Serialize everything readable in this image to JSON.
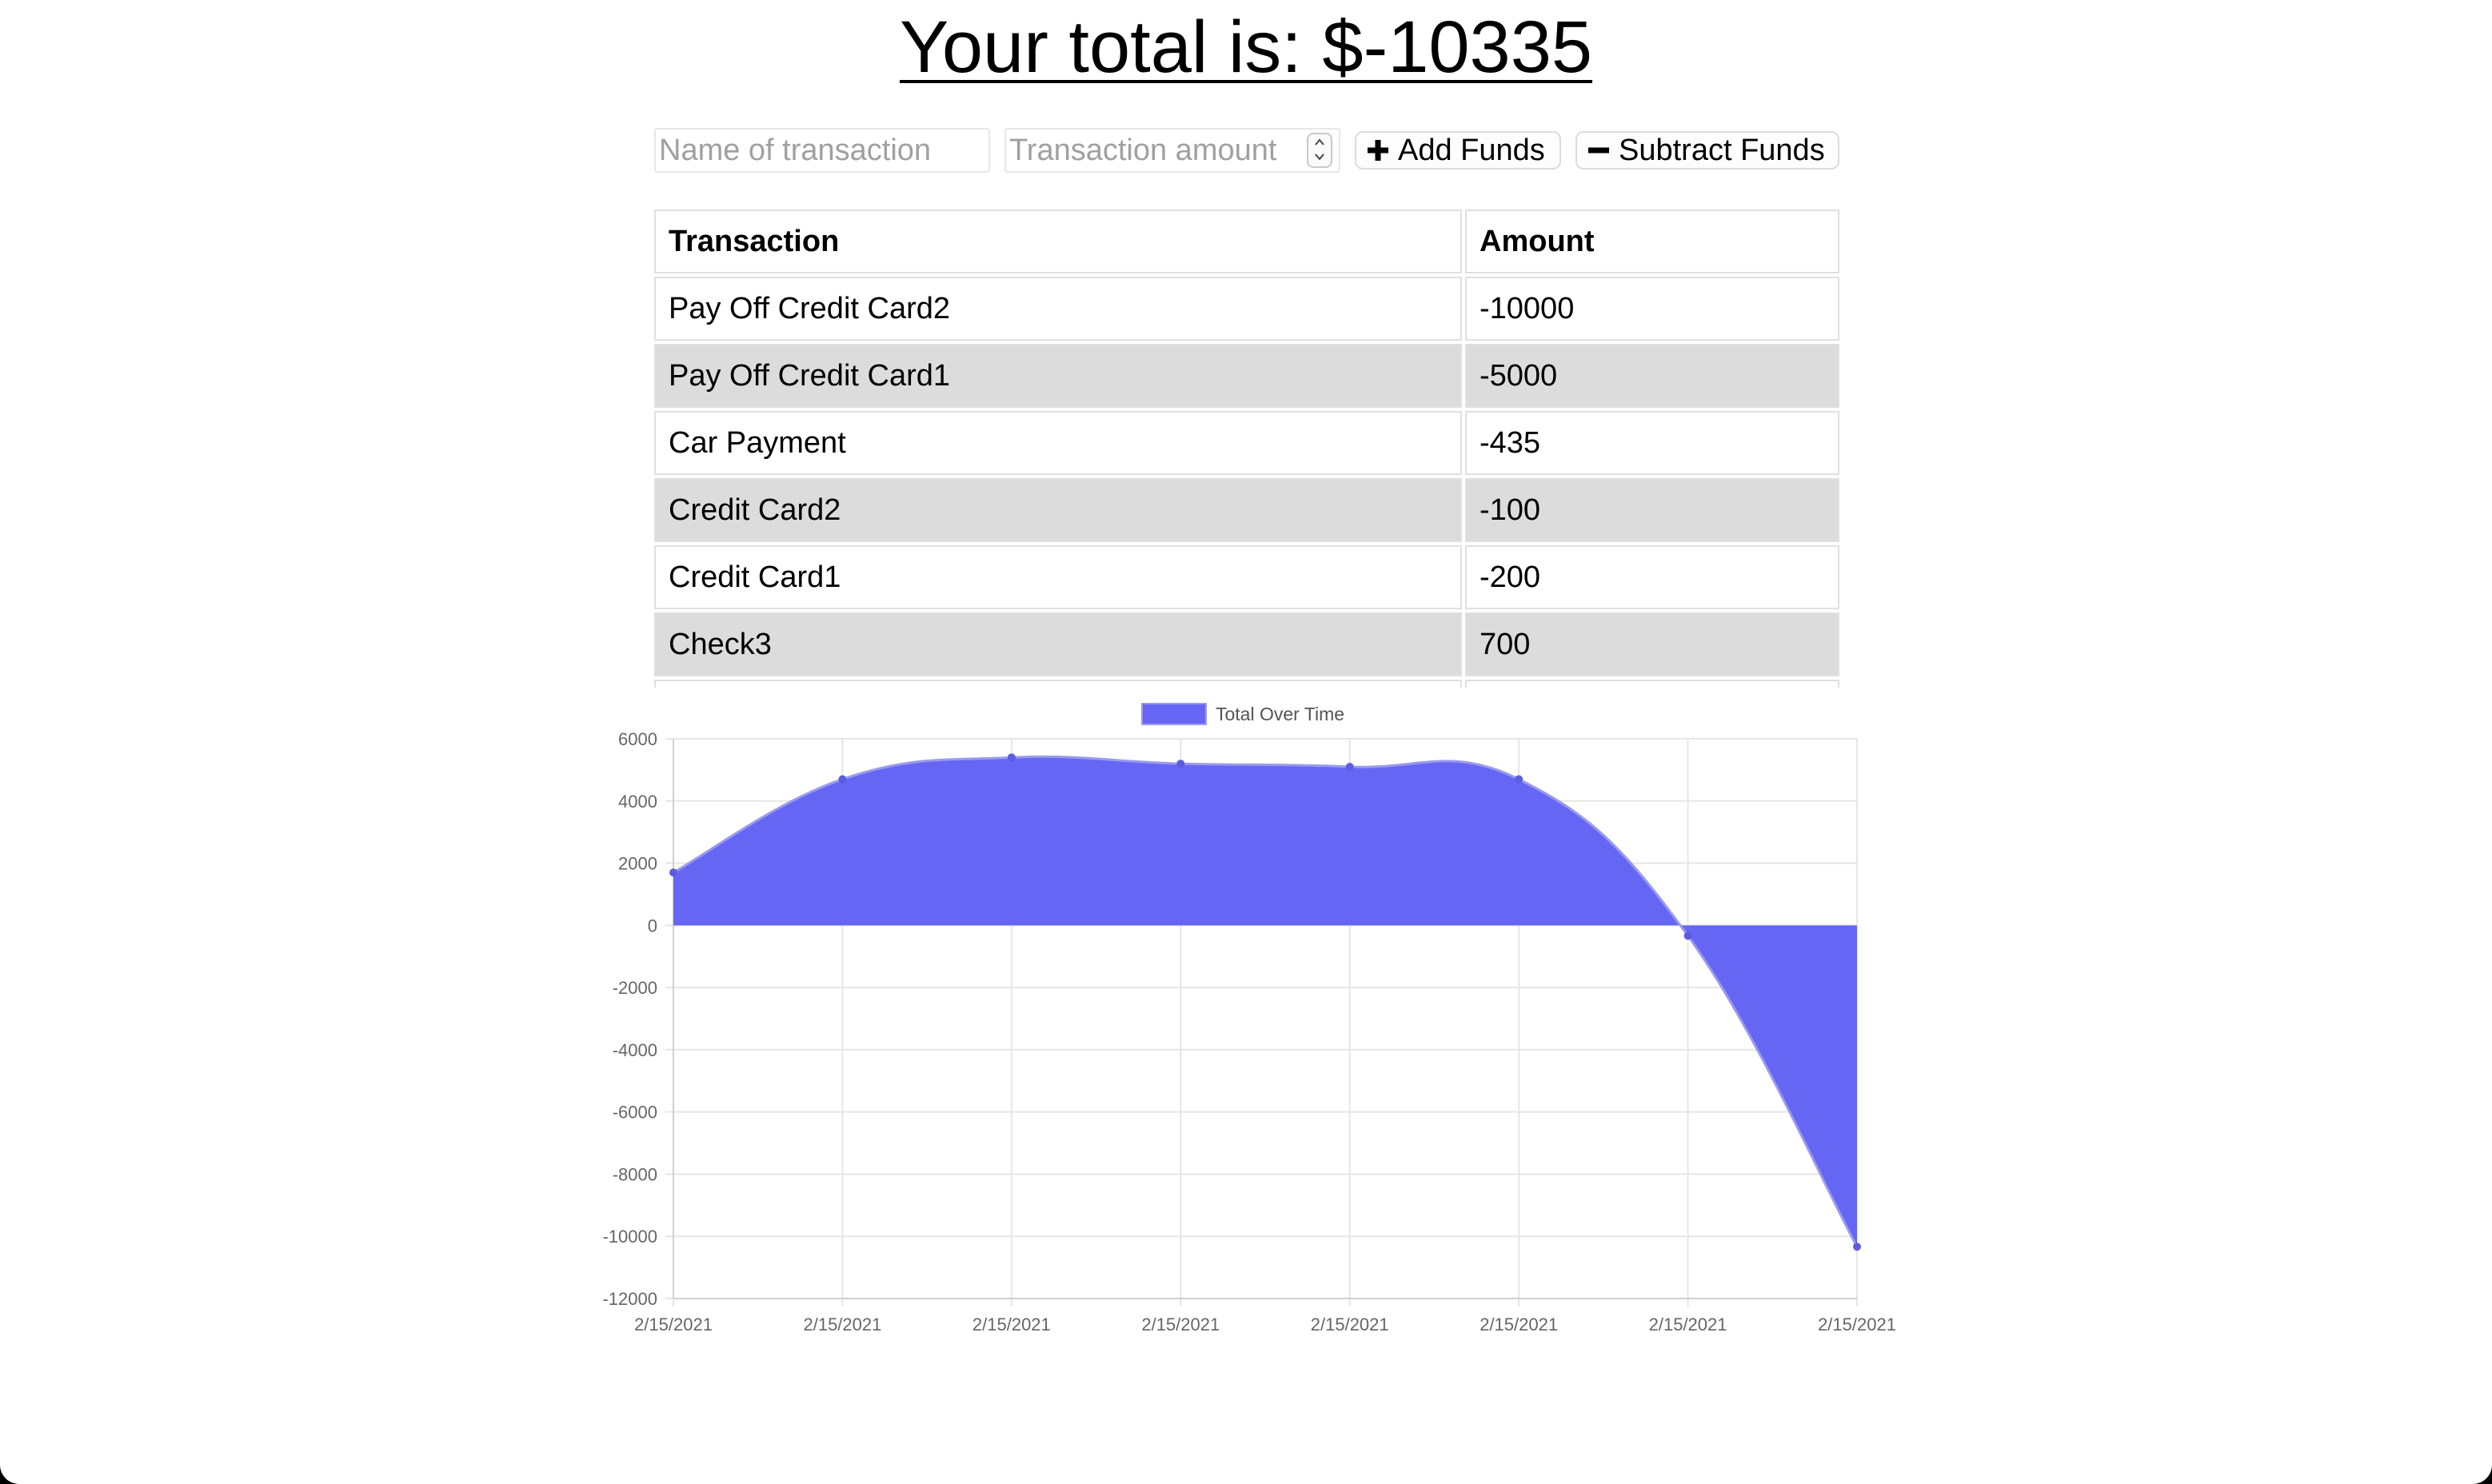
{
  "header": {
    "total_text": "Your total is: $-10335"
  },
  "form": {
    "name_placeholder": "Name of transaction",
    "amount_placeholder": "Transaction amount",
    "add_label": "Add Funds",
    "subtract_label": "Subtract Funds"
  },
  "table": {
    "headers": [
      "Transaction",
      "Amount"
    ],
    "rows": [
      {
        "name": "Pay Off Credit Card2",
        "amount": "-10000"
      },
      {
        "name": "Pay Off Credit Card1",
        "amount": "-5000"
      },
      {
        "name": "Car Payment",
        "amount": "-435"
      },
      {
        "name": "Credit Card2",
        "amount": "-100"
      },
      {
        "name": "Credit Card1",
        "amount": "-200"
      },
      {
        "name": "Check3",
        "amount": "700"
      },
      {
        "name": "",
        "amount": ""
      }
    ]
  },
  "chart_data": {
    "type": "area",
    "legend_position": "top",
    "grid": true,
    "colors": {
      "fill": "#6666f5",
      "line": "#9a9aee",
      "point": "#5c5ce0"
    },
    "series": [
      {
        "name": "Total Over Time",
        "x": [
          "2/15/2021",
          "2/15/2021",
          "2/15/2021",
          "2/15/2021",
          "2/15/2021",
          "2/15/2021",
          "2/15/2021",
          "2/15/2021"
        ],
        "values": [
          1700,
          4700,
          5400,
          5200,
          5100,
          4700,
          -335,
          -10335
        ]
      }
    ],
    "yticks": [
      6000,
      4000,
      2000,
      0,
      -2000,
      -4000,
      -6000,
      -8000,
      -10000,
      -12000
    ],
    "ylim": [
      -12000,
      6000
    ]
  }
}
